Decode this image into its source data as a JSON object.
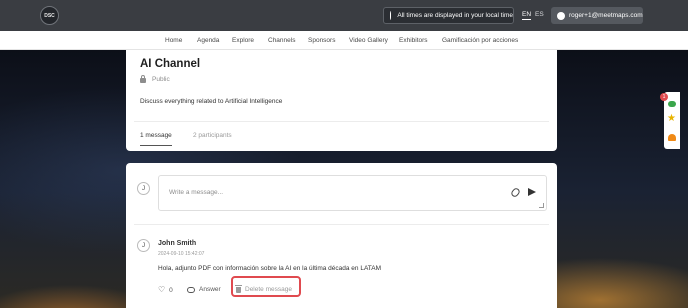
{
  "topbar": {
    "logo_text": "DSC",
    "timezone_text": "All times are displayed in your local time",
    "languages": [
      "EN",
      "ES"
    ],
    "active_language": "EN",
    "user_email": "roger+1@meetmaps.com"
  },
  "nav": {
    "items": [
      "Home",
      "Agenda",
      "Explore",
      "Channels",
      "Sponsors",
      "Video Gallery",
      "Exhibitors",
      "Gamificación por acciones"
    ]
  },
  "channel": {
    "title": "AI Channel",
    "visibility": "Public",
    "description": "Discuss everything related to Artificial Intelligence",
    "tabs": [
      "1 message",
      "2 participants"
    ]
  },
  "composer": {
    "avatar_initial": "J",
    "placeholder": "Write a message..."
  },
  "message": {
    "avatar_initial": "J",
    "author": "John Smith",
    "timestamp": "2024-09-10 15:42:07",
    "text": "Hola, adjunto PDF con información sobre la AI en la última década en LATAM",
    "likes": "0",
    "answer_label": "Answer",
    "delete_label": "Delete message"
  },
  "sidewidget": {
    "badge_count": "1"
  },
  "colors": {
    "topbar": "#3a3d42",
    "highlight": "#e04a4f",
    "chat_green": "#3aa64b",
    "star_yellow": "#e8b400",
    "bell_orange": "#f08a16"
  }
}
